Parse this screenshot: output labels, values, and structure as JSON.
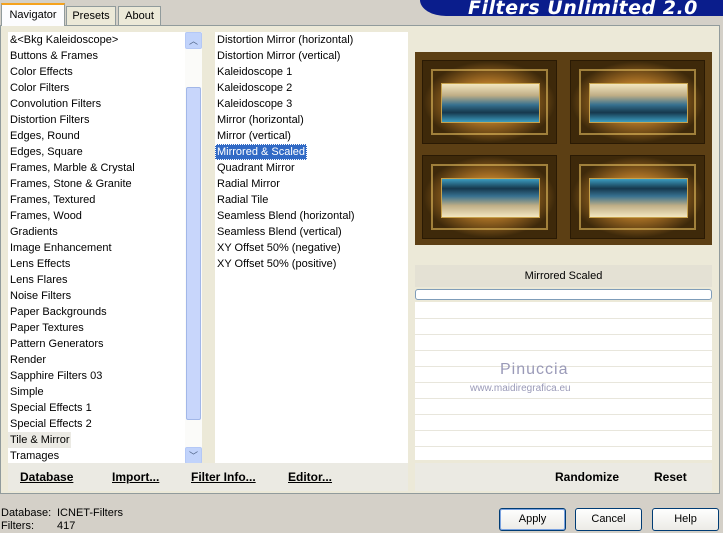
{
  "window": {
    "banner_title": "Filters Unlimited 2.0"
  },
  "tabs": [
    {
      "label": "Navigator"
    },
    {
      "label": "Presets"
    },
    {
      "label": "About"
    }
  ],
  "categories": {
    "items": [
      "&<Bkg Kaleidoscope>",
      "Buttons & Frames",
      "Color Effects",
      "Color Filters",
      "Convolution Filters",
      "Distortion Filters",
      "Edges, Round",
      "Edges, Square",
      "Frames, Marble & Crystal",
      "Frames, Stone & Granite",
      "Frames, Textured",
      "Frames, Wood",
      "Gradients",
      "Image Enhancement",
      "Lens Effects",
      "Lens Flares",
      "Noise Filters",
      "Paper Backgrounds",
      "Paper Textures",
      "Pattern Generators",
      "Render",
      "Sapphire Filters 03",
      "Simple",
      "Special Effects 1",
      "Special Effects 2",
      "Tile & Mirror",
      "Tramages"
    ],
    "selected": "Tile & Mirror"
  },
  "filters": {
    "items": [
      "Distortion Mirror (horizontal)",
      "Distortion Mirror (vertical)",
      "Kaleidoscope 1",
      "Kaleidoscope 2",
      "Kaleidoscope 3",
      "Mirror (horizontal)",
      "Mirror (vertical)",
      "Mirrored & Scaled",
      "Quadrant Mirror",
      "Radial Mirror",
      "Radial Tile",
      "Seamless Blend (horizontal)",
      "Seamless Blend (vertical)",
      "XY Offset 50% (negative)",
      "XY Offset 50% (positive)"
    ],
    "selected": "Mirrored & Scaled"
  },
  "bottom_links": {
    "database": "Database",
    "import": "Import...",
    "filter_info": "Filter Info...",
    "editor": "Editor..."
  },
  "preview": {
    "filter_name": "Mirrored  Scaled",
    "progress": 0,
    "watermark": "Pinuccia",
    "watermark_url": "www.maidiregrafica.eu"
  },
  "right_buttons": {
    "randomize": "Randomize",
    "reset": "Reset"
  },
  "status": {
    "database_label": "Database:",
    "database_value": "ICNET-Filters",
    "filters_label": "Filters:",
    "filters_value": "417"
  },
  "dialog_buttons": {
    "apply": "Apply",
    "cancel": "Cancel",
    "help": "Help"
  },
  "colors": {
    "accent": "#316ac5",
    "banner": "#0a1d8c",
    "tab_highlight": "#f5a21e"
  }
}
